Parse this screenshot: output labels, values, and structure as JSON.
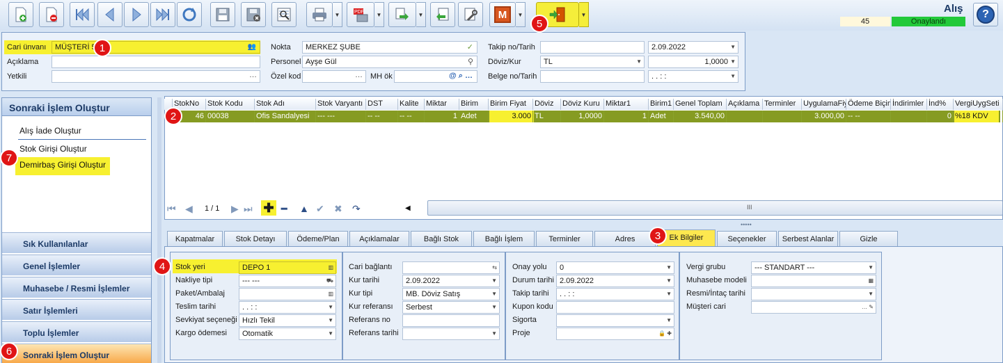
{
  "toolbar": {
    "buttons": [
      {
        "name": "new-document-icon"
      },
      {
        "name": "delete-document-icon"
      },
      {
        "name": "first-record-icon"
      },
      {
        "name": "previous-record-icon"
      },
      {
        "name": "next-record-icon"
      },
      {
        "name": "last-record-icon"
      },
      {
        "name": "refresh-icon"
      },
      {
        "name": "save-icon"
      },
      {
        "name": "cancel-save-icon"
      },
      {
        "name": "preview-icon"
      },
      {
        "name": "print-icon"
      },
      {
        "name": "pdf-export-icon"
      },
      {
        "name": "transfer-icon"
      },
      {
        "name": "return-icon"
      },
      {
        "name": "tools-icon"
      },
      {
        "name": "m-icon"
      },
      {
        "name": "exit-door-icon"
      }
    ],
    "m_letter": "M"
  },
  "doc": {
    "title": "Alış",
    "number": "45",
    "status": "Onaylandı",
    "help": "?"
  },
  "badges": {
    "b1": "1",
    "b2": "2",
    "b3": "3",
    "b4": "4",
    "b5": "5",
    "b6": "6",
    "b7": "7"
  },
  "header": {
    "cari_label": "Cari ünvanı",
    "cari_value": "MÜŞTERİ 5",
    "aciklama_label": "Açıklama",
    "aciklama_value": "",
    "yetkili_label": "Yetkili",
    "yetkili_value": "",
    "nokta_label": "Nokta",
    "nokta_value": "MERKEZ ŞUBE",
    "personel_label": "Personel",
    "personel_value": "Ayşe Gül",
    "ozelkod_label": "Özel kod",
    "ozelkod_value": "",
    "mhok_label": "MH ök",
    "mhok_value": "",
    "takip_label": "Takip no/Tarih",
    "takip_value": "",
    "takip_date": "2.09.2022",
    "doviz_label": "Döviz/Kur",
    "doviz_value": "TL",
    "kur_value": "1,0000",
    "belge_label": "Belge no/Tarih",
    "belge_value": "",
    "belge_date": ". .  : :"
  },
  "left_panel": {
    "title": "Sonraki İşlem Oluştur",
    "items": [
      "Alış İade Oluştur",
      "Stok Girişi Oluştur",
      "Demirbaş Girişi Oluştur"
    ],
    "nav": [
      "Sık Kullanılanlar",
      "Genel İşlemler",
      "Muhasebe / Resmi İşlemler",
      "Satır İşlemleri",
      "Toplu İşlemler",
      "Sonraki İşlem Oluştur"
    ]
  },
  "grid": {
    "columns": [
      "StokNo",
      "Stok Kodu",
      "Stok Adı",
      "Stok Varyantı",
      "DST",
      "Kalite",
      "Miktar",
      "Birim",
      "Birim Fiyat",
      "Döviz",
      "Döviz Kuru",
      "Miktar1",
      "Birim1",
      "Genel Toplam",
      "Açıklama",
      "Terminler",
      "UygulamaFiy",
      "Ödeme Biçim",
      "İndirimler",
      "İnd%",
      "VergiUygSeti"
    ],
    "row": [
      "46",
      "00038",
      "Ofis Sandalyesi",
      "--- ---",
      "-- --",
      "-- --",
      "1",
      "Adet",
      "3.000",
      "TL",
      "1,0000",
      "1",
      "Adet",
      "3.540,00",
      "",
      "",
      "3.000,00",
      "-- --",
      "",
      "0",
      "%18 KDV"
    ],
    "pager": "1 / 1",
    "scroll_glyph": "III"
  },
  "tabs": [
    "Kapatmalar",
    "Stok Detayı",
    "Ödeme/Plan",
    "Açıklamalar",
    "Bağlı Stok",
    "Bağlı İşlem",
    "Terminler",
    "Adres",
    "Ek Bilgiler",
    "Seçenekler",
    "Serbest Alanlar",
    "Gizle"
  ],
  "ek": {
    "s1": [
      {
        "label": "Stok yeri",
        "value": "DEPO 1"
      },
      {
        "label": "Nakliye tipi",
        "value": "--- ---"
      },
      {
        "label": "Paket/Ambalaj",
        "value": ""
      },
      {
        "label": "Teslim tarihi",
        "value": ". .  : :"
      },
      {
        "label": "Sevkiyat seçeneği",
        "value": "Hızlı Tekil"
      },
      {
        "label": "Kargo ödemesi",
        "value": "Otomatik"
      }
    ],
    "s2": [
      {
        "label": "Cari bağlantı",
        "value": ""
      },
      {
        "label": "Kur tarihi",
        "value": "2.09.2022"
      },
      {
        "label": "Kur tipi",
        "value": "MB. Döviz Satış"
      },
      {
        "label": "Kur referansı",
        "value": "Serbest"
      },
      {
        "label": "Referans no",
        "value": ""
      },
      {
        "label": "Referans tarihi",
        "value": ""
      }
    ],
    "s3": [
      {
        "label": "Onay yolu",
        "value": "0"
      },
      {
        "label": "Durum tarihi",
        "value": "2.09.2022"
      },
      {
        "label": "Takip tarihi",
        "value": ". .  : :"
      },
      {
        "label": "Kupon kodu",
        "value": ""
      },
      {
        "label": "Sigorta",
        "value": ""
      },
      {
        "label": "Proje",
        "value": ""
      }
    ],
    "s4": [
      {
        "label": "Vergi grubu",
        "value": "--- STANDART ---"
      },
      {
        "label": "Muhasebe modeli",
        "value": ""
      },
      {
        "label": "Resmi/İntaç tarihi",
        "value": ""
      },
      {
        "label": "Müşteri cari",
        "value": ""
      }
    ]
  }
}
